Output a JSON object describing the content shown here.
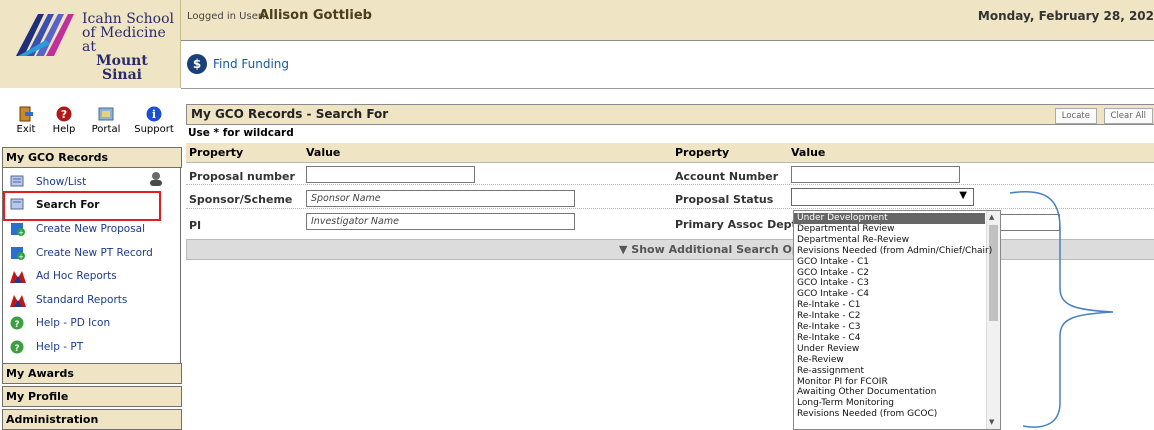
{
  "logo": {
    "line1": "Icahn School",
    "line2": "of Medicine at",
    "line3": "Mount",
    "line4": "Sinai"
  },
  "topbar": {
    "logged_label": "Logged in User:",
    "user": "Allison Gottlieb",
    "date": "Monday, February 28, 202"
  },
  "find": {
    "icon": "$",
    "label": "Find Funding"
  },
  "toolbar": [
    {
      "label": "Exit",
      "icon": "exit-icon"
    },
    {
      "label": "Help",
      "icon": "help-icon"
    },
    {
      "label": "Portal",
      "icon": "portal-icon"
    },
    {
      "label": "Support",
      "icon": "info-icon"
    }
  ],
  "sidebar": {
    "section1": "My GCO Records",
    "items": [
      {
        "label": "Show/List",
        "icon": "list-icon"
      },
      {
        "label": "Search For",
        "icon": "search-record-icon"
      },
      {
        "label": "Create New Proposal",
        "icon": "add-icon"
      },
      {
        "label": "Create New PT Record",
        "icon": "add-icon"
      },
      {
        "label": "Ad Hoc Reports",
        "icon": "report-icon"
      },
      {
        "label": "Standard Reports",
        "icon": "report-icon"
      },
      {
        "label": "Help - PD Icon",
        "icon": "help-circle-icon"
      },
      {
        "label": "Help - PT",
        "icon": "help-circle-icon"
      }
    ],
    "section2": "My Awards",
    "section3": "My Profile",
    "section4": "Administration"
  },
  "main": {
    "title": "My GCO Records - Search For",
    "locate": "Locate",
    "clear_all": "Clear All",
    "wildcard": "Use * for wildcard",
    "col_property": "Property",
    "col_value": "Value",
    "col_property2": "Property",
    "col_value2": "Value",
    "proposal_number": "Proposal number",
    "account_number": "Account Number",
    "sponsor": "Sponsor/Scheme",
    "sponsor_placeholder": "Sponsor Name",
    "proposal_status": "Proposal Status",
    "pi": "PI",
    "pi_placeholder": "Investigator Name",
    "primary_dept": "Primary Assoc Dept",
    "show_more": "Show Additional Search Options"
  },
  "dropdown_options": [
    "Under Development",
    "Departmental Review",
    "Departmental Re-Review",
    "Revisions Needed (from Admin/Chief/Chair)",
    "GCO Intake - C1",
    "GCO Intake - C2",
    "GCO Intake - C3",
    "GCO Intake - C4",
    "Re-Intake - C1",
    "Re-Intake - C2",
    "Re-Intake - C3",
    "Re-Intake - C4",
    "Under Review",
    "Re-Review",
    "Re-assignment",
    "Monitor PI for FCOIR",
    "Awaiting Other Documentation",
    "Long-Term Monitoring",
    "Revisions Needed (from GCOC)"
  ],
  "colors": {
    "header_bg": "#efe4c4",
    "link": "#1b3a8a",
    "highlight": "#e02020",
    "brace": "#4a7fc0"
  }
}
